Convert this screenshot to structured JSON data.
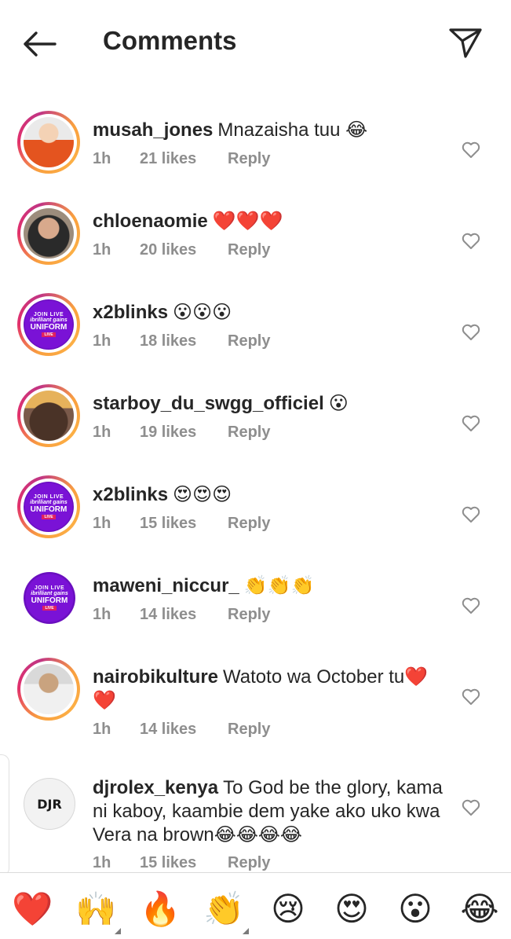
{
  "header": {
    "title": "Comments",
    "back_icon": "arrow-left-icon",
    "send_icon": "paper-plane-icon"
  },
  "comments": [
    {
      "username": "musah_jones",
      "text": "Mnazaisha tuu 😂",
      "time": "1h",
      "likes": "21 likes",
      "reply": "Reply"
    },
    {
      "username": "chloenaomie",
      "text": "❤️❤️❤️",
      "time": "1h",
      "likes": "20 likes",
      "reply": "Reply"
    },
    {
      "username": "x2blinks",
      "text": "😮😮😮",
      "time": "1h",
      "likes": "18 likes",
      "reply": "Reply"
    },
    {
      "username": "starboy_du_swgg_officiel",
      "text": "😮",
      "time": "1h",
      "likes": "19 likes",
      "reply": "Reply"
    },
    {
      "username": "x2blinks",
      "text": "😍😍😍",
      "time": "1h",
      "likes": "15 likes",
      "reply": "Reply"
    },
    {
      "username": "maweni_niccur_",
      "text": "👏👏👏",
      "time": "1h",
      "likes": "14 likes",
      "reply": "Reply"
    },
    {
      "username": "nairobikulture",
      "text": "Watoto wa October tu❤️❤️",
      "time": "1h",
      "likes": "14 likes",
      "reply": "Reply"
    },
    {
      "username": "djrolex_kenya",
      "text": "To God be the glory, kama ni kaboy, kaambie dem yake ako uko kwa Vera na brown😂😂😂😂",
      "time": "1h",
      "likes": "15 likes",
      "reply": "Reply"
    }
  ],
  "avatar_badge": {
    "line1": "JOIN LIVE",
    "line2": "ibrilliant gains",
    "line3": "UNIFORM",
    "line4": "LIVE"
  },
  "logo_text": "DJR",
  "emoji_bar": [
    "❤️",
    "🙌",
    "🔥",
    "👏",
    "😢",
    "😍",
    "😮",
    "😂"
  ],
  "colors": {
    "ring_start": "#f9a03f",
    "ring_end": "#c13584",
    "meta_gray": "#8e8e8e",
    "text": "#262626",
    "heart": "#e0245e"
  }
}
